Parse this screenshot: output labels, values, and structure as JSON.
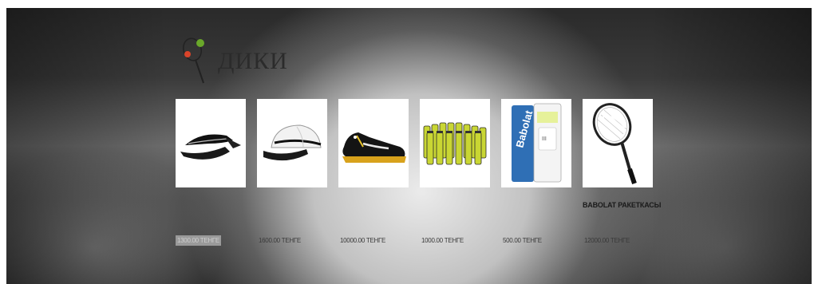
{
  "logo": {
    "text": "ДИКИ"
  },
  "products": [
    {
      "icon": "visor-cap-icon",
      "price": "1300.00 ТЕНГЕ",
      "name": ""
    },
    {
      "icon": "white-cap-icon",
      "price": "1600.00 ТЕНГЕ",
      "name": ""
    },
    {
      "icon": "tennis-shoe-icon",
      "price": "10000.00 ТЕНГЕ",
      "name": ""
    },
    {
      "icon": "tennis-balls-box-icon",
      "price": "1000.00 ТЕНГЕ",
      "name": ""
    },
    {
      "icon": "overgrip-pack-icon",
      "price": "500.00 ТЕНГЕ",
      "name": ""
    },
    {
      "icon": "tennis-racket-icon",
      "price": "12000.00 ТЕНГЕ",
      "name": "BABOLAT РАКЕТКАСЫ"
    }
  ],
  "colors": {
    "accent_green": "#6aa82a",
    "accent_red": "#d9442a",
    "ball_yellow": "#c9d633"
  }
}
